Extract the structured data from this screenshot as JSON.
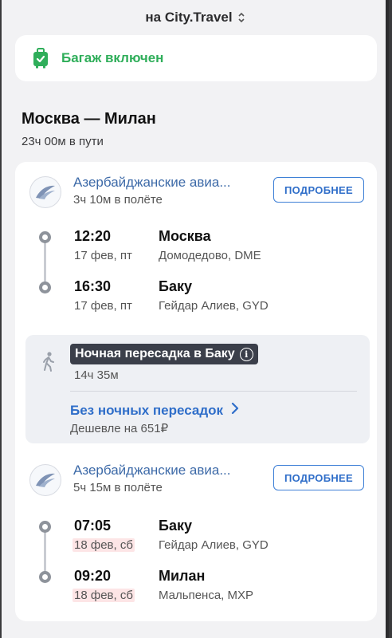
{
  "header": {
    "source": "на City.Travel"
  },
  "baggage": {
    "label": "Багаж включен"
  },
  "route": {
    "title": "Москва — Милан",
    "total_duration": "23ч 00м в пути"
  },
  "segments": [
    {
      "airline": "Азербайджанские авиа...",
      "duration": "3ч 10м в полёте",
      "details_label": "ПОДРОБНЕЕ",
      "departure": {
        "time": "12:20",
        "date": "17 фев, пт",
        "city": "Москва",
        "airport": "Домодедово, DME"
      },
      "arrival": {
        "time": "16:30",
        "date": "17 фев, пт",
        "city": "Баку",
        "airport": "Гейдар Алиев, GYD"
      }
    },
    {
      "airline": "Азербайджанские авиа...",
      "duration": "5ч 15м в полёте",
      "details_label": "ПОДРОБНЕЕ",
      "departure": {
        "time": "07:05",
        "date": "18 фев, сб",
        "city": "Баку",
        "airport": "Гейдар Алиев, GYD"
      },
      "arrival": {
        "time": "09:20",
        "date": "18 фев, сб",
        "city": "Милан",
        "airport": "Мальпенса, MXP"
      }
    }
  ],
  "layover": {
    "title": "Ночная пересадка в Баку",
    "duration": "14ч 35м",
    "alternative_link": "Без ночных пересадок",
    "alternative_note": "Дешевле на 651₽"
  },
  "colors": {
    "accent": "#2f6ec9",
    "success": "#2fae5a",
    "night_badge": "#3b3f4a",
    "date_warning": "#fde5e6"
  }
}
